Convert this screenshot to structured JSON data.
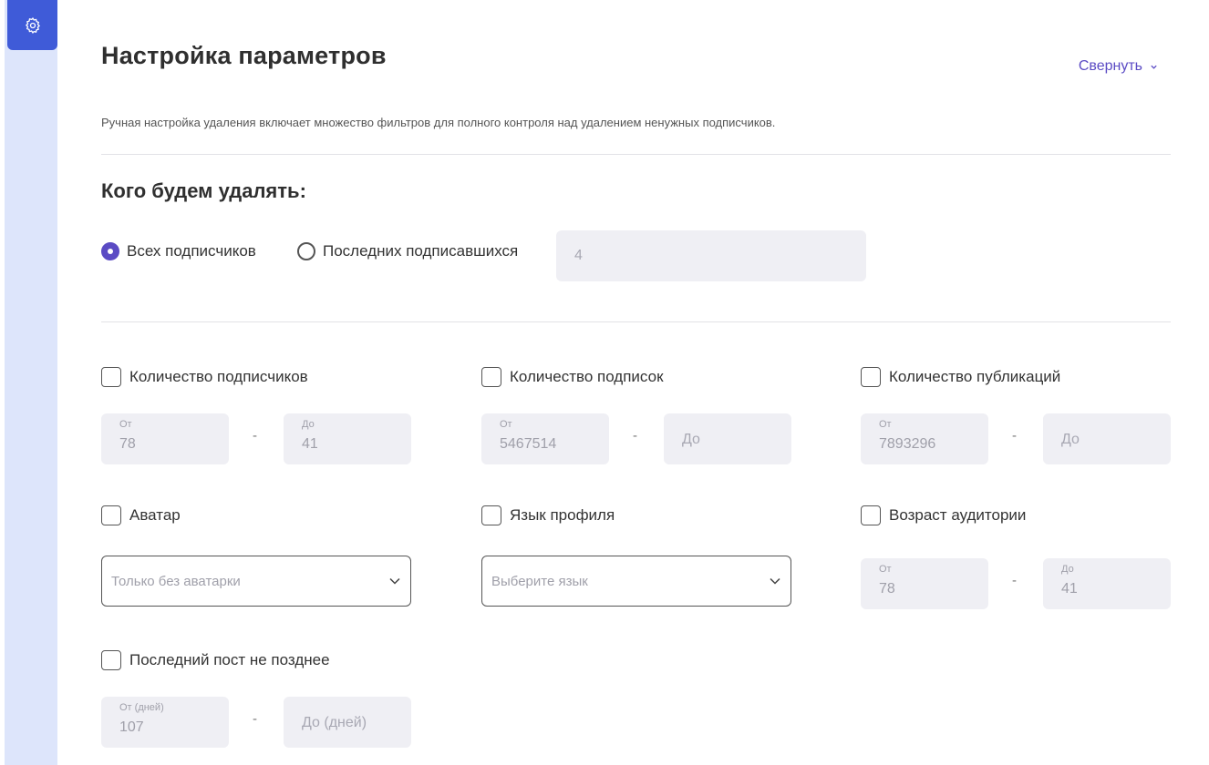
{
  "sidebar": {
    "settings_icon": "gear-icon",
    "accent": "#3f5bd8"
  },
  "header": {
    "title": "Настройка параметров",
    "collapse_label": "Свернуть",
    "description": "Ручная настройка удаления включает множество фильтров для полного контроля над удалением ненужных подписчиков."
  },
  "who": {
    "title": "Кого будем удалять:",
    "option_all": "Всех подписчиков",
    "option_last": "Последних подписавшихся",
    "selected": "all",
    "last_count_value": "4"
  },
  "filters": {
    "followers": {
      "label": "Количество подписчиков",
      "from_label": "От",
      "from_value": "78",
      "to_label": "До",
      "to_value": "41"
    },
    "followings": {
      "label": "Количество подписок",
      "from_label": "От",
      "from_value": "5467514",
      "to_placeholder": "До"
    },
    "posts": {
      "label": "Количество публикаций",
      "from_label": "От",
      "from_value": "7893296",
      "to_placeholder": "До"
    },
    "avatar": {
      "label": "Аватар",
      "select_value": "Только без аватарки"
    },
    "language": {
      "label": "Язык профиля",
      "select_placeholder": "Выберите язык"
    },
    "age": {
      "label": "Возраст аудитории",
      "from_label": "От",
      "from_value": "78",
      "to_label": "До",
      "to_value": "41"
    },
    "last_post": {
      "label": "Последний пост не позднее",
      "from_label": "От (дней)",
      "from_value": "107",
      "to_placeholder": "До (дней)"
    },
    "dash": "-"
  }
}
